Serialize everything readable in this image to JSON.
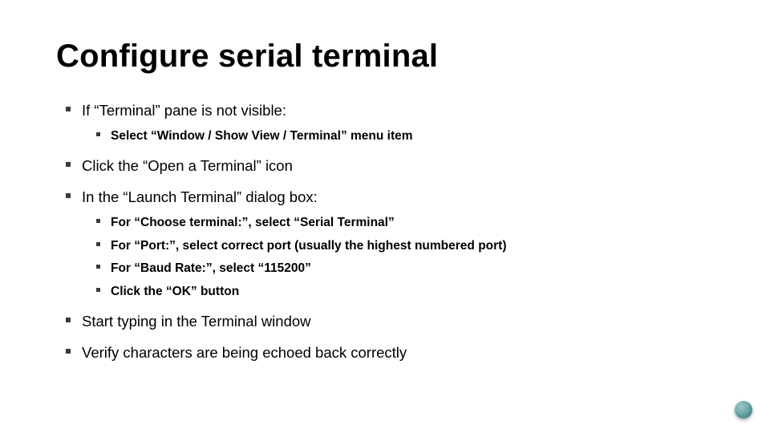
{
  "title": "Configure serial terminal",
  "bullets": [
    {
      "text": "If “Terminal” pane is not visible:",
      "sub": [
        "Select “Window / Show View / Terminal” menu item"
      ]
    },
    {
      "text": "Click the “Open a Terminal” icon"
    },
    {
      "text": "In the “Launch Terminal” dialog box:",
      "sub": [
        "For “Choose terminal:”, select “Serial Terminal”",
        "For “Port:”, select correct port (usually the highest numbered port)",
        "For “Baud Rate:”, select “115200”",
        "Click the “OK” button"
      ]
    },
    {
      "text": "Start typing in the Terminal window"
    },
    {
      "text": "Verify characters are being echoed back correctly"
    }
  ]
}
